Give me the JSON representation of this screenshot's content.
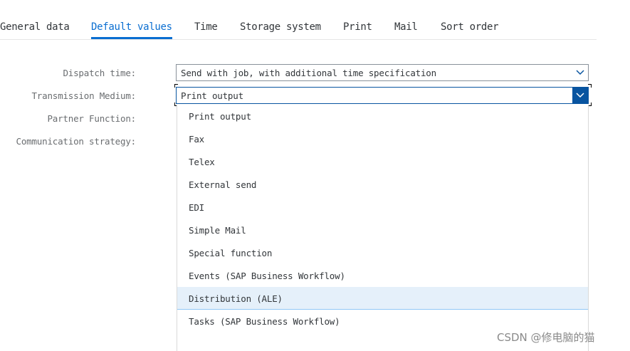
{
  "tabs": [
    {
      "label": "General data",
      "active": false
    },
    {
      "label": "Default values",
      "active": true
    },
    {
      "label": "Time",
      "active": false
    },
    {
      "label": "Storage system",
      "active": false
    },
    {
      "label": "Print",
      "active": false
    },
    {
      "label": "Mail",
      "active": false
    },
    {
      "label": "Sort order",
      "active": false
    }
  ],
  "form": {
    "dispatch_time": {
      "label": "Dispatch time:",
      "value": "Send with job, with additional time specification"
    },
    "transmission_medium": {
      "label": "Transmission Medium:",
      "value": "Print output"
    },
    "partner_function": {
      "label": "Partner Function:"
    },
    "communication_strategy": {
      "label": "Communication strategy:"
    }
  },
  "dropdown": {
    "options": [
      "Print output",
      "Fax",
      "Telex",
      "External send",
      "EDI",
      "Simple Mail",
      "Special function",
      "Events (SAP Business Workflow)",
      "Distribution (ALE)",
      "Tasks (SAP Business Workflow)"
    ],
    "highlighted": "Distribution (ALE)"
  },
  "watermark": "CSDN @修电脑的猫",
  "colors": {
    "accent": "#0a6ed1",
    "button": "#0854a0",
    "highlight": "#e5f0fa"
  },
  "icons": {
    "dropdown_button": "chevron-down-icon"
  }
}
